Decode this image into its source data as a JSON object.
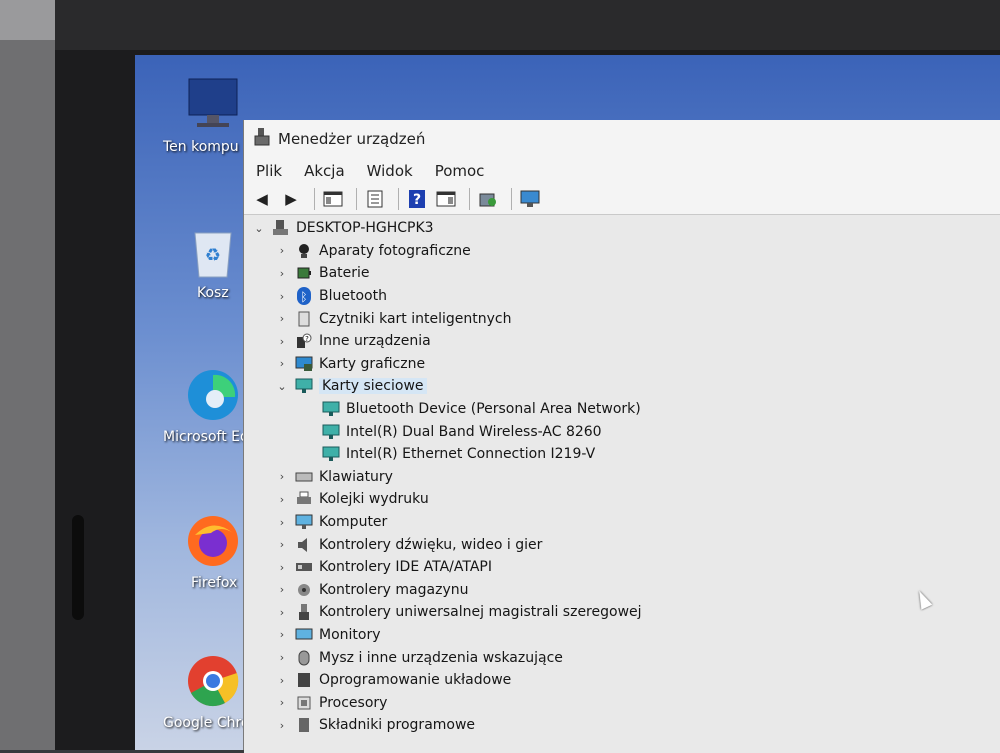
{
  "window": {
    "title": "Menedżer urządzeń",
    "menu": [
      "Plik",
      "Akcja",
      "Widok",
      "Pomoc"
    ],
    "toolbar_icons": [
      "back-arrow-icon",
      "forward-arrow-icon",
      "console-tree-icon",
      "properties-icon",
      "help-icon",
      "action-pane-icon",
      "scan-hardware-icon",
      "monitor-icon"
    ]
  },
  "desktop": {
    "icons": [
      {
        "label": "Ten kompu",
        "icon": "computer-icon"
      },
      {
        "label": "Kosz",
        "icon": "recycle-bin-icon"
      },
      {
        "label": "Microsoft Ed",
        "icon": "edge-icon"
      },
      {
        "label": "Firefox",
        "icon": "firefox-icon"
      },
      {
        "label": "Google Chro",
        "icon": "chrome-icon"
      }
    ]
  },
  "tree": {
    "root": "DESKTOP-HGHCPK3",
    "categories": [
      {
        "label": "Aparaty fotograficzne",
        "expanded": false
      },
      {
        "label": "Baterie",
        "expanded": false
      },
      {
        "label": "Bluetooth",
        "expanded": false
      },
      {
        "label": "Czytniki kart inteligentnych",
        "expanded": false
      },
      {
        "label": "Inne urządzenia",
        "expanded": false
      },
      {
        "label": "Karty graficzne",
        "expanded": false
      },
      {
        "label": "Karty sieciowe",
        "expanded": true,
        "selected": true,
        "children": [
          "Bluetooth Device (Personal Area Network)",
          "Intel(R) Dual Band Wireless-AC 8260",
          "Intel(R) Ethernet Connection I219-V"
        ]
      },
      {
        "label": "Klawiatury",
        "expanded": false
      },
      {
        "label": "Kolejki wydruku",
        "expanded": false
      },
      {
        "label": "Komputer",
        "expanded": false
      },
      {
        "label": "Kontrolery dźwięku, wideo i gier",
        "expanded": false
      },
      {
        "label": "Kontrolery IDE ATA/ATAPI",
        "expanded": false
      },
      {
        "label": "Kontrolery magazynu",
        "expanded": false
      },
      {
        "label": "Kontrolery uniwersalnej magistrali szeregowej",
        "expanded": false
      },
      {
        "label": "Monitory",
        "expanded": false
      },
      {
        "label": "Mysz i inne urządzenia wskazujące",
        "expanded": false
      },
      {
        "label": "Oprogramowanie układowe",
        "expanded": false
      },
      {
        "label": "Procesory",
        "expanded": false
      },
      {
        "label": "Składniki programowe",
        "expanded": false
      }
    ]
  },
  "colors": {
    "desktop_top": "#3b63b8",
    "selection": "#d5e6f5",
    "window_bg": "#efefef"
  }
}
